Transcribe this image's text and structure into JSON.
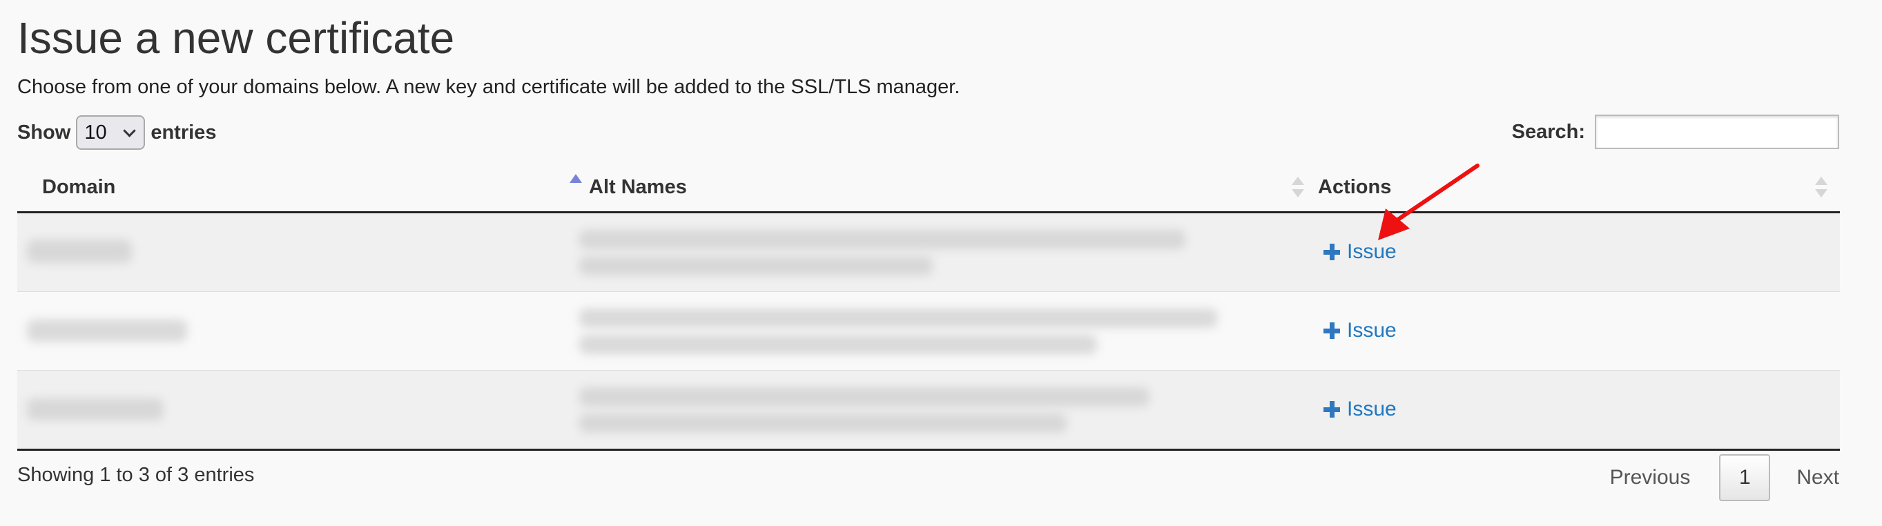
{
  "page": {
    "title": "Issue a new certificate",
    "intro": "Choose from one of your domains below. A new key and certificate will be added to the SSL/TLS manager."
  },
  "controls": {
    "show_label": "Show",
    "entries_value": "10",
    "entries_label": "entries",
    "search_label": "Search:",
    "search_value": ""
  },
  "table": {
    "columns": [
      {
        "label": "Domain",
        "sort": "ascending"
      },
      {
        "label": "Alt Names",
        "sort": "none"
      },
      {
        "label": "Actions",
        "sort": "none"
      }
    ],
    "rows": [
      {
        "domain": "",
        "alt_names": "",
        "action": "Issue"
      },
      {
        "domain": "",
        "alt_names": "",
        "action": "Issue"
      },
      {
        "domain": "",
        "alt_names": "",
        "action": "Issue"
      }
    ]
  },
  "footer": {
    "info": "Showing 1 to 3 of 3 entries",
    "previous": "Previous",
    "current_page": "1",
    "next": "Next"
  },
  "colors": {
    "link": "#1f78c1",
    "annotation_arrow": "#ee1111",
    "sort_active": "#7a84d6"
  },
  "icons": {
    "issue": "plus-icon",
    "select": "chevron-down-icon"
  }
}
